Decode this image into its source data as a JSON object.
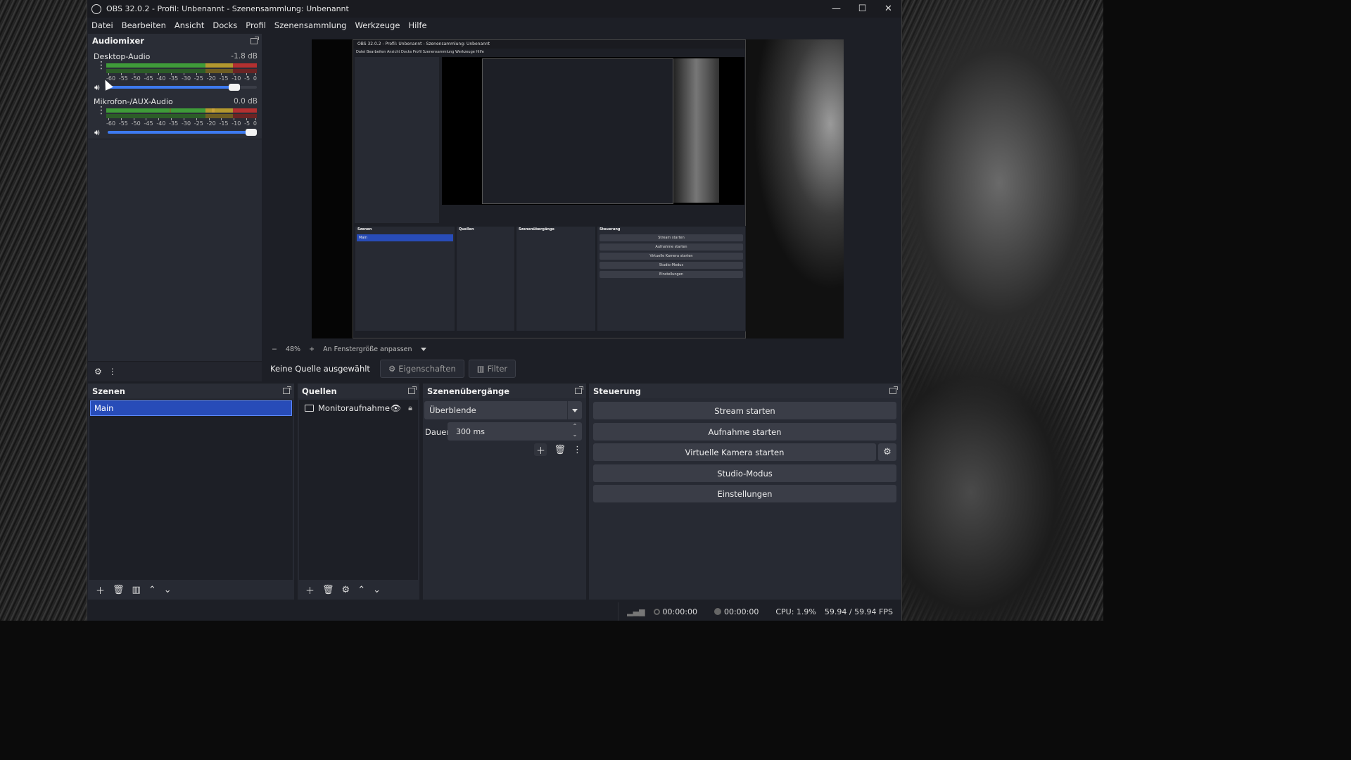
{
  "window": {
    "title": "OBS 32.0.2 - Profil: Unbenannt - Szenensammlung: Unbenannt",
    "controls": [
      "—",
      "☐",
      "✕"
    ]
  },
  "menu": [
    "Datei",
    "Bearbeiten",
    "Ansicht",
    "Docks",
    "Profil",
    "Szenensammlung",
    "Werkzeuge",
    "Hilfe"
  ],
  "audiomixer": {
    "title": "Audiomixer",
    "channels": [
      {
        "name": "Desktop-Audio",
        "db": "-1.8 dB",
        "volume": 0.88
      },
      {
        "name": "Mikrofon-/AUX-Audio",
        "db": "0.0 dB",
        "volume": 1.0
      }
    ],
    "scale": [
      "-60",
      "-55",
      "-50",
      "-45",
      "-40",
      "-35",
      "-30",
      "-25",
      "-20",
      "-15",
      "-10",
      "-5",
      "0"
    ]
  },
  "preview": {
    "nested_title": "OBS 32.0.2 - Profil: Unbenannt - Szenensammlung: Unbenannt",
    "nested_menu": "Datei  Bearbeiten  Ansicht  Docks  Profil  Szenensammlung  Werkzeuge  Hilfe"
  },
  "zoom": {
    "minus": "−",
    "value": "48%",
    "plus": "+",
    "fit_label": "An Fenstergröße anpassen"
  },
  "source_toolbar": {
    "no_source": "Keine Quelle ausgewählt",
    "properties": "Eigenschaften",
    "filter": "Filter"
  },
  "scenes": {
    "title": "Szenen",
    "items": [
      "Main"
    ]
  },
  "sources": {
    "title": "Quellen",
    "items": [
      "Monitoraufnahme"
    ]
  },
  "transitions": {
    "title": "Szenenübergänge",
    "selected": "Überblende",
    "duration_label": "Dauer",
    "duration_value": "300 ms"
  },
  "controls": {
    "title": "Steuerung",
    "stream": "Stream starten",
    "record": "Aufnahme starten",
    "virtualcam": "Virtuelle Kamera starten",
    "studio": "Studio-Modus",
    "settings": "Einstellungen"
  },
  "status": {
    "stream_time": "00:00:00",
    "record_time": "00:00:00",
    "cpu": "CPU: 1.9%",
    "fps": "59.94 / 59.94 FPS"
  }
}
